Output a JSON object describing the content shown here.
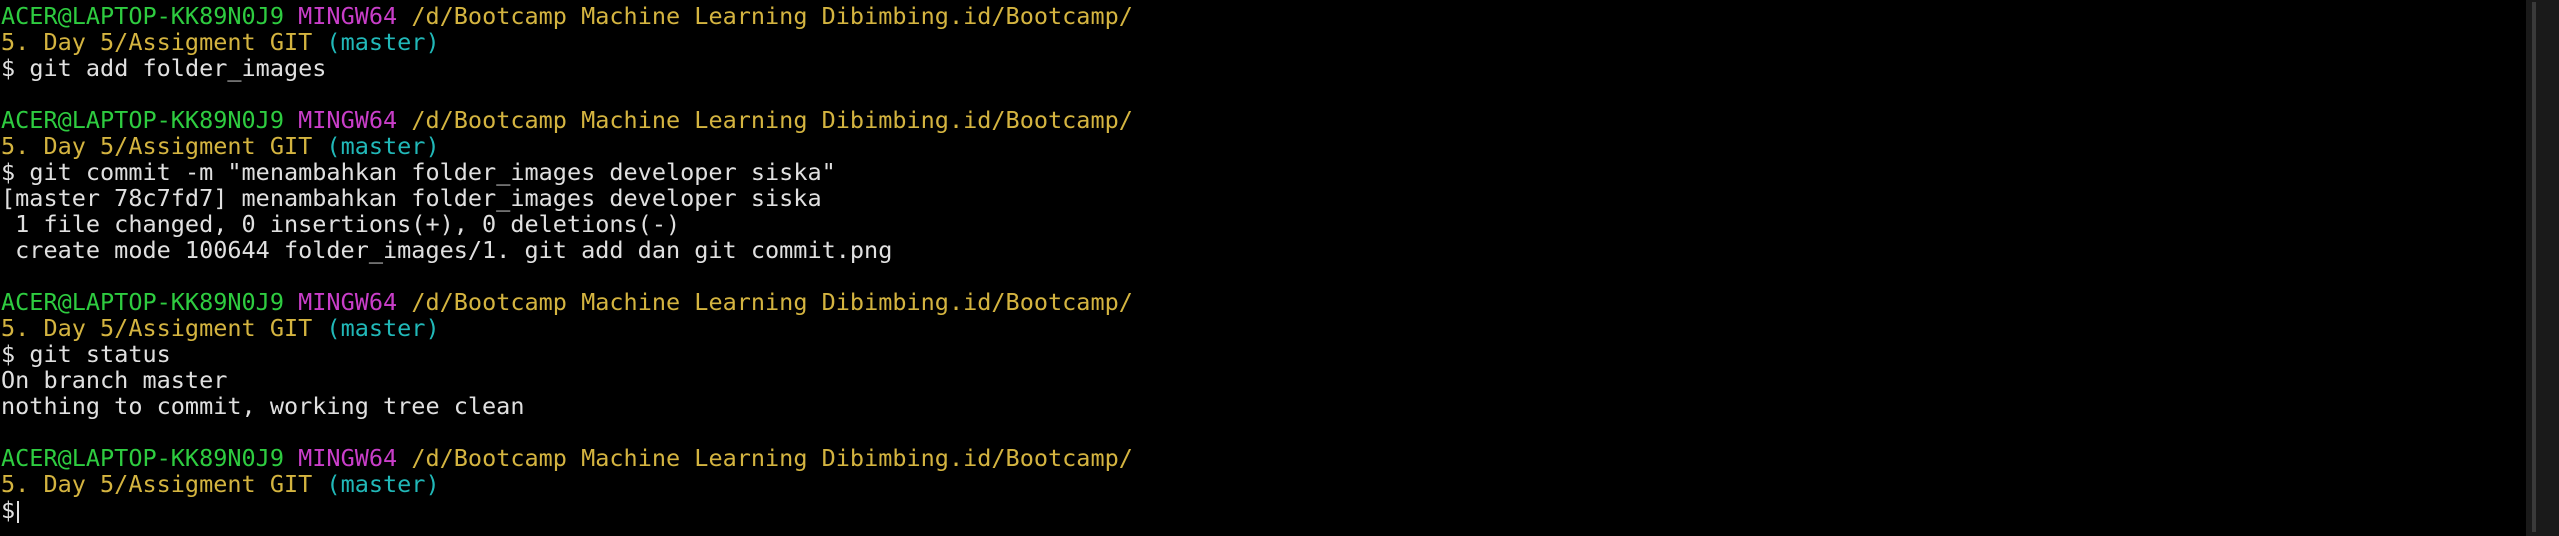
{
  "terminal": {
    "colors": {
      "background": "#000000",
      "user": "#2ecc40",
      "system": "#c93ec9",
      "path": "#d4b440",
      "branch": "#21b8b8",
      "output": "#e0e0e0"
    },
    "prompt": {
      "user_host": "ACER@LAPTOP-KK89N0J9",
      "system": "MINGW64",
      "path_part1": "/d/Bootcamp Machine Learning Dibimbing.id/Bootcamp/",
      "path_part2": "5. Day 5/Assigment GIT",
      "branch": "(master)",
      "symbol": "$"
    },
    "blocks": [
      {
        "command": "git add folder_images",
        "output": []
      },
      {
        "command": "git commit -m \"menambahkan folder_images developer siska\"",
        "output": [
          "[master 78c7fd7] menambahkan folder_images developer siska",
          " 1 file changed, 0 insertions(+), 0 deletions(-)",
          " create mode 100644 folder_images/1. git add dan git commit.png"
        ]
      },
      {
        "command": "git status",
        "output": [
          "On branch master",
          "nothing to commit, working tree clean"
        ]
      },
      {
        "command": "",
        "output": []
      }
    ]
  }
}
